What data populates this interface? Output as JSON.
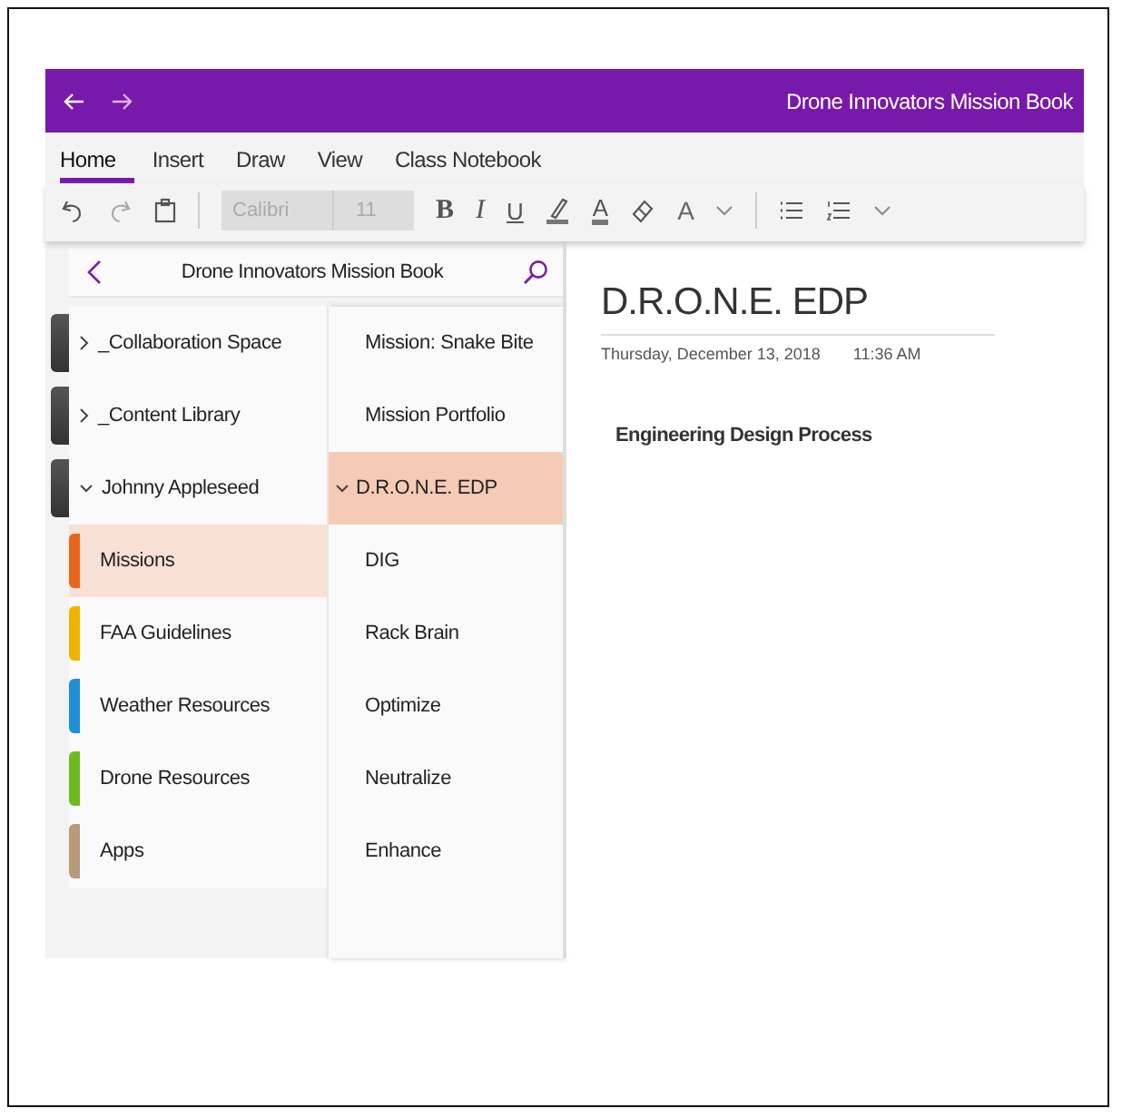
{
  "window": {
    "title": "Drone Innovators Mission Book"
  },
  "tabs": [
    {
      "label": "Home",
      "selected": true
    },
    {
      "label": "Insert",
      "selected": false
    },
    {
      "label": "Draw",
      "selected": false
    },
    {
      "label": "View",
      "selected": false
    },
    {
      "label": "Class Notebook",
      "selected": false
    }
  ],
  "toolbar": {
    "font": "Calibri",
    "size": "11",
    "format": [
      "B",
      "I",
      "U"
    ],
    "font_color": "A",
    "styles": "A"
  },
  "sidebar": {
    "title": "Drone Innovators Mission Book",
    "sections": [
      {
        "kind": "group",
        "label": "_Collaboration Space",
        "expanded": false,
        "selected": false
      },
      {
        "kind": "group",
        "label": "_Content Library",
        "expanded": false,
        "selected": false
      },
      {
        "kind": "group",
        "label": "Johnny Appleseed",
        "expanded": true,
        "selected": false
      },
      {
        "kind": "section",
        "label": "Missions",
        "color": "#e8641b",
        "selected": true
      },
      {
        "kind": "section",
        "label": "FAA Guidelines",
        "color": "#f0b400",
        "selected": false
      },
      {
        "kind": "section",
        "label": "Weather Resources",
        "color": "#1e90d6",
        "selected": false
      },
      {
        "kind": "section",
        "label": "Drone Resources",
        "color": "#6cbb1e",
        "selected": false
      },
      {
        "kind": "section",
        "label": "Apps",
        "color": "#b89a78",
        "selected": false
      }
    ],
    "pages": [
      {
        "kind": "page",
        "label": "Mission: Snake Bite",
        "selected": false
      },
      {
        "kind": "page",
        "label": "Mission Portfolio",
        "selected": false
      },
      {
        "kind": "group",
        "label": "D.R.O.N.E. EDP",
        "expanded": true,
        "selected": true
      },
      {
        "kind": "page",
        "label": "DIG",
        "selected": false
      },
      {
        "kind": "page",
        "label": "Rack Brain",
        "selected": false
      },
      {
        "kind": "page",
        "label": "Optimize",
        "selected": false
      },
      {
        "kind": "page",
        "label": "Neutralize",
        "selected": false
      },
      {
        "kind": "page",
        "label": "Enhance",
        "selected": false
      }
    ]
  },
  "page": {
    "title": "D.R.O.N.E. EDP",
    "date": "Thursday, December 13, 2018",
    "time": "11:36 AM",
    "body": "Engineering Design Process"
  }
}
